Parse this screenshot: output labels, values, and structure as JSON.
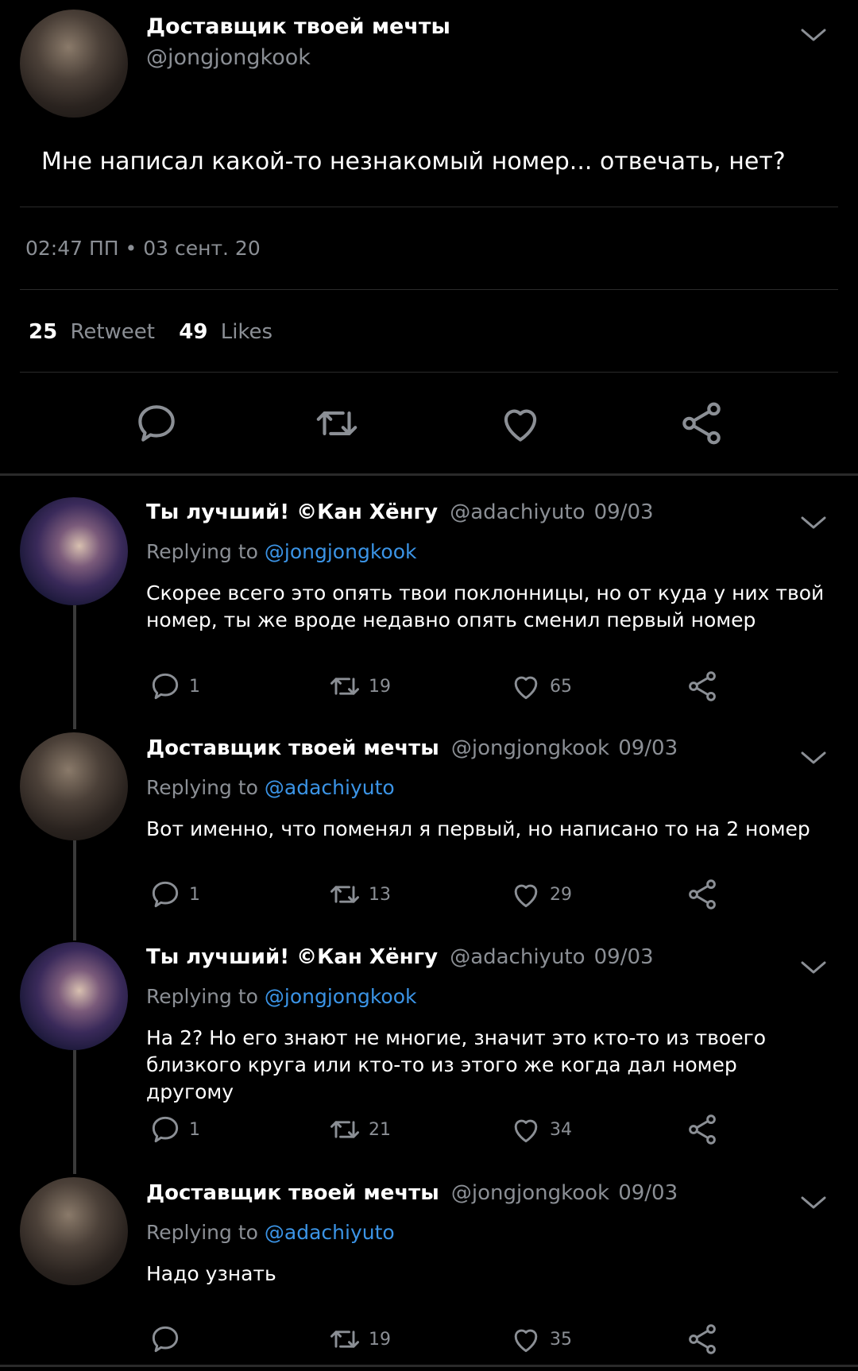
{
  "main_tweet": {
    "name": "Доставщик твоей мечты",
    "handle": "@jongjongkook",
    "text": "Мне написал какой-то незнакомый номер... отвечать, нет?",
    "timestamp": "02:47 ПП • 03 сент. 20",
    "retweets_count": "25",
    "retweets_label": "Retweet",
    "likes_count": "49",
    "likes_label": "Likes"
  },
  "replies": [
    {
      "name": "Ты лучший! ©Кан Хёнгу",
      "handle": "@adachiyuto",
      "date": "09/03",
      "replying_prefix": "Replying to",
      "replying_to": "@jongjongkook",
      "text": "Скорее всего это опять твои поклонницы, но от куда у них твой номер, ты же вроде недавно опять сменил первый номер",
      "replies": "1",
      "retweets": "19",
      "likes": "65"
    },
    {
      "name": "Доставщик твоей мечты",
      "handle": "@jongjongkook",
      "date": "09/03",
      "replying_prefix": "Replying to",
      "replying_to": "@adachiyuto",
      "text": "Вот именно, что поменял я первый, но написано то на 2 номер",
      "replies": "1",
      "retweets": "13",
      "likes": "29"
    },
    {
      "name": "Ты лучший! ©Кан Хёнгу",
      "handle": "@adachiyuto",
      "date": "09/03",
      "replying_prefix": "Replying to",
      "replying_to": "@jongjongkook",
      "text": "На 2? Но его знают не многие, значит это кто-то из твоего близкого круга или кто-то из этого же когда дал номер другому",
      "replies": "1",
      "retweets": "21",
      "likes": "34"
    },
    {
      "name": "Доставщик твоей мечты",
      "handle": "@jongjongkook",
      "date": "09/03",
      "replying_prefix": "Replying to",
      "replying_to": "@adachiyuto",
      "text": "Надо узнать",
      "replies": "",
      "retweets": "19",
      "likes": "35"
    }
  ],
  "colors": {
    "background": "#000000",
    "secondary_text": "#8b8f95",
    "link": "#3b94e6",
    "divider": "#2a2a2a"
  }
}
